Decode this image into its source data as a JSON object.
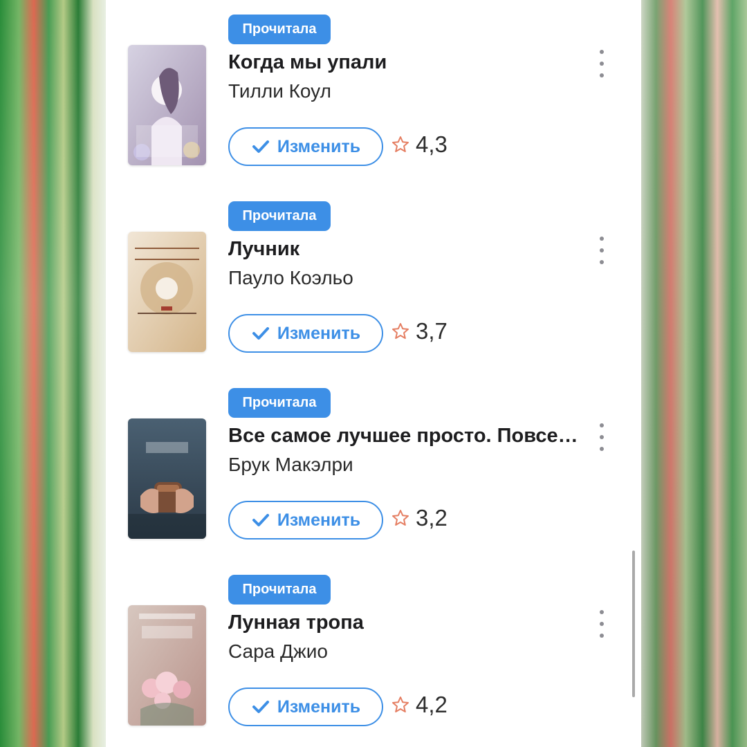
{
  "books": [
    {
      "status": "Прочитала",
      "title": "Когда мы упали",
      "author": "Тилли Коул",
      "button": "Изменить",
      "rating": "4,3",
      "cover_colors": [
        "#c9c7d7",
        "#a28ea7",
        "#fbfbfd",
        "#cfcaf6"
      ]
    },
    {
      "status": "Прочитала",
      "title": "Лучник",
      "author": "Пауло Коэльо",
      "button": "Изменить",
      "rating": "3,7",
      "cover_colors": [
        "#f1e6d6",
        "#b7884a",
        "#2b2b2b",
        "#e4cba4"
      ]
    },
    {
      "status": "Прочитала",
      "title": "Все самое лучшее просто. Повсед…",
      "author": "Брук Макэлри",
      "button": "Изменить",
      "rating": "3,2",
      "cover_colors": [
        "#3b4a58",
        "#607181",
        "#b68a6c",
        "#1f2b35"
      ]
    },
    {
      "status": "Прочитала",
      "title": "Лунная тропа",
      "author": "Сара Джио",
      "button": "Изменить",
      "rating": "4,2",
      "cover_colors": [
        "#d7c7bf",
        "#c89b93",
        "#f2e2de",
        "#9d6f6b"
      ]
    }
  ],
  "theme": {
    "accent": "#3d8fe6",
    "star_color": "#e57e62",
    "badge_text": "#ffffff",
    "background": "#ffffff"
  }
}
